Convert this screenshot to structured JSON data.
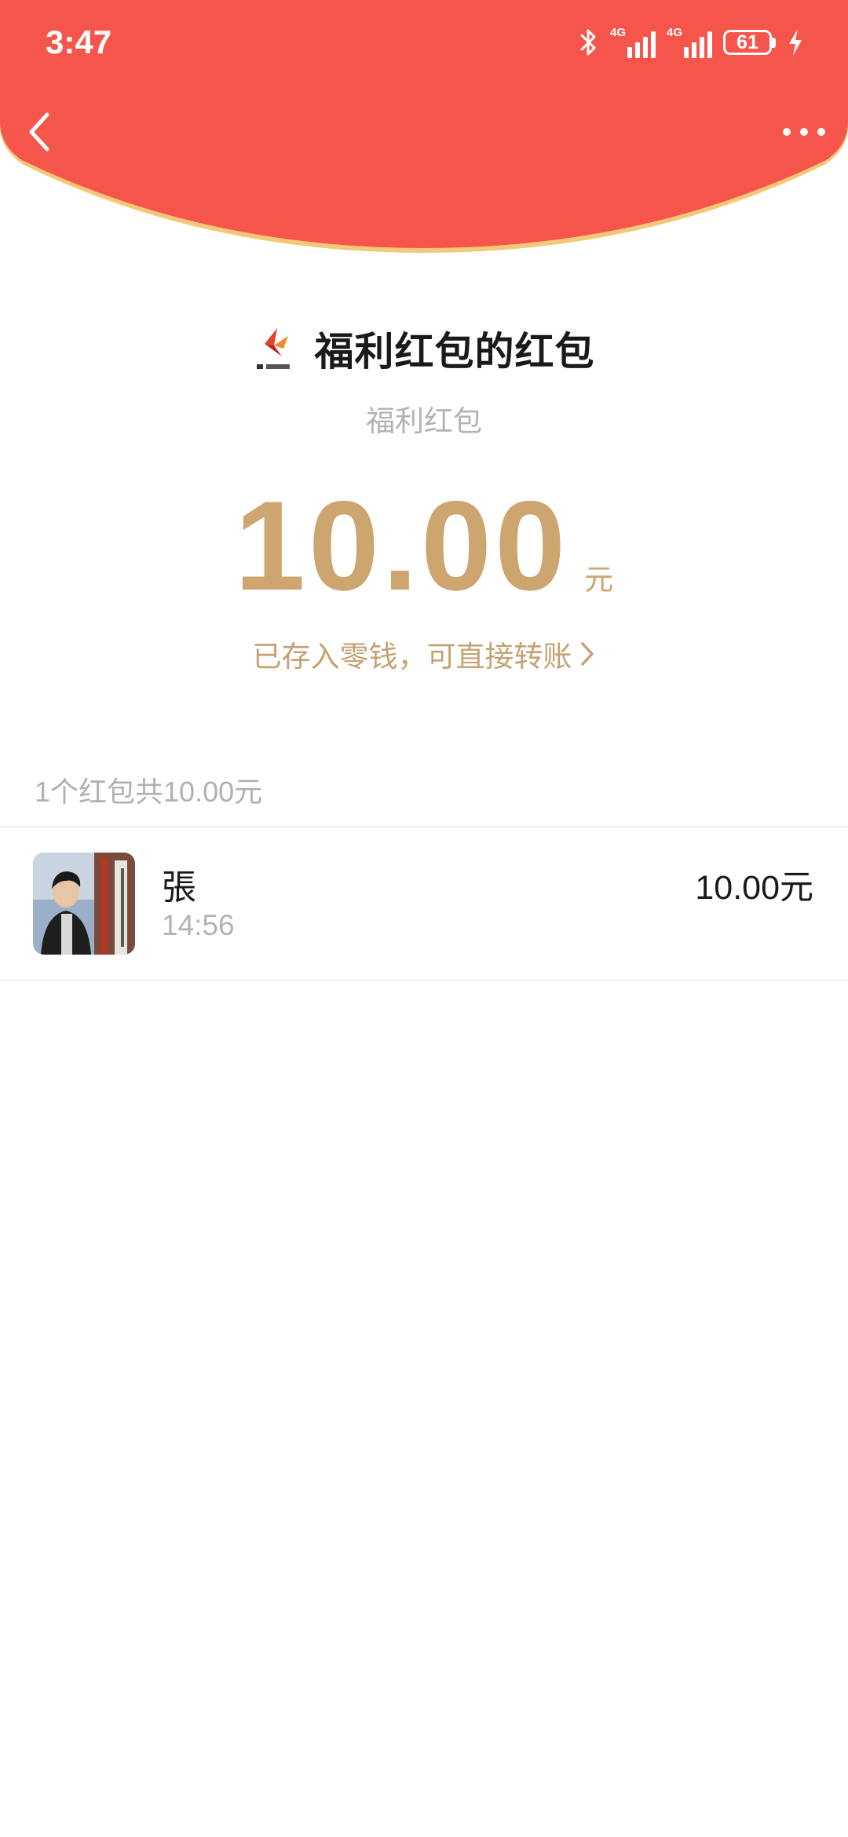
{
  "colors": {
    "header": "#f5554a",
    "gold": "#cda56f",
    "gold_text": "#c4a272"
  },
  "status_bar": {
    "time": "3:47",
    "sim1_label": "4G",
    "sim2_label": "4G",
    "battery": "61",
    "icons": [
      "bluetooth-icon",
      "signal-icon",
      "battery-icon",
      "charging-icon"
    ]
  },
  "nav": {
    "back_icon": "chevron-left-icon",
    "more_icon": "more-dots-icon"
  },
  "envelope": {
    "title": "福利红包的红包",
    "subtitle": "福利红包",
    "amount": "10.00",
    "amount_unit": "元",
    "link_text": "已存入零钱，可直接转账"
  },
  "summary": {
    "text": "1个红包共10.00元"
  },
  "records": [
    {
      "name": "張",
      "time": "14:56",
      "amount": "10.00元"
    }
  ]
}
